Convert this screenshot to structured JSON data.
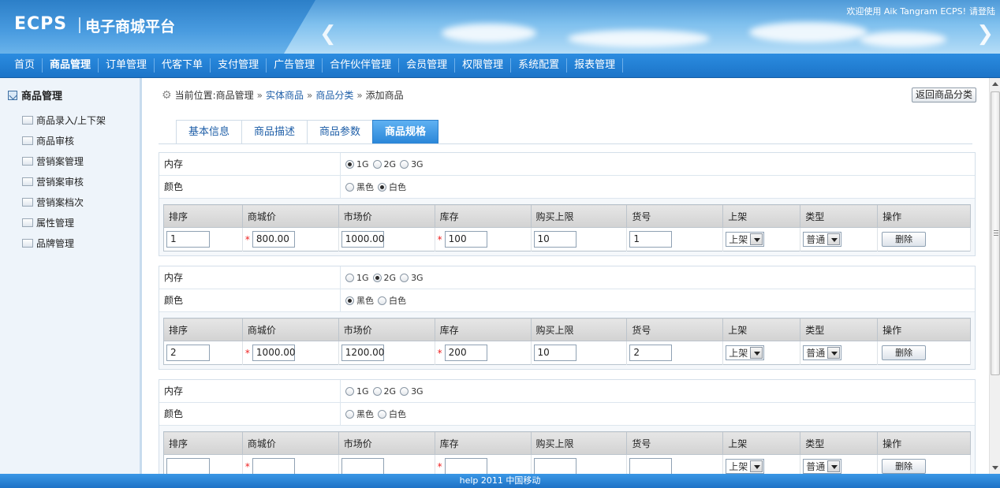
{
  "header": {
    "logo": "ECPS",
    "title": "电子商城平台",
    "welcome": "欢迎使用 Aik Tangram ECPS!",
    "login": "请登陆"
  },
  "nav": [
    "首页",
    "商品管理",
    "订单管理",
    "代客下单",
    "支付管理",
    "广告管理",
    "合作伙伴管理",
    "会员管理",
    "权限管理",
    "系统配置",
    "报表管理"
  ],
  "nav_active": "商品管理",
  "sidebar": {
    "title": "商品管理",
    "items": [
      "商品录入/上下架",
      "商品审核",
      "营销案管理",
      "营销案审核",
      "营销案档次",
      "属性管理",
      "品牌管理"
    ]
  },
  "breadcrumb": {
    "prefix": "当前位置:商品管理",
    "sep": "»",
    "links": [
      "实体商品",
      "商品分类"
    ],
    "current": "添加商品"
  },
  "back_button": "返回商品分类",
  "tabs": [
    "基本信息",
    "商品描述",
    "商品参数",
    "商品规格"
  ],
  "active_tab": "商品规格",
  "labels": {
    "memory": "内存",
    "color": "颜色"
  },
  "memory_options": [
    "1G",
    "2G",
    "3G"
  ],
  "color_options": [
    "黑色",
    "白色"
  ],
  "columns": [
    "排序",
    "商城价",
    "市场价",
    "库存",
    "购买上限",
    "货号",
    "上架",
    "类型",
    "操作"
  ],
  "specs": [
    {
      "memory": "1G",
      "color": "白色",
      "sort": "1",
      "mall_price": "800.00",
      "market_price": "1000.00",
      "stock": "100",
      "limit": "10",
      "sku": "1",
      "shelf": "上架",
      "type": "普通",
      "action": "删除"
    },
    {
      "memory": "2G",
      "color": "黑色",
      "sort": "2",
      "mall_price": "1000.00",
      "market_price": "1200.00",
      "stock": "200",
      "limit": "10",
      "sku": "2",
      "shelf": "上架",
      "type": "普通",
      "action": "删除"
    },
    {
      "memory": "",
      "color": "",
      "sort": "",
      "mall_price": "",
      "market_price": "",
      "stock": "",
      "limit": "",
      "sku": "",
      "shelf": "上架",
      "type": "普通",
      "action": "删除"
    }
  ],
  "footer": "help 2011 中国移动"
}
